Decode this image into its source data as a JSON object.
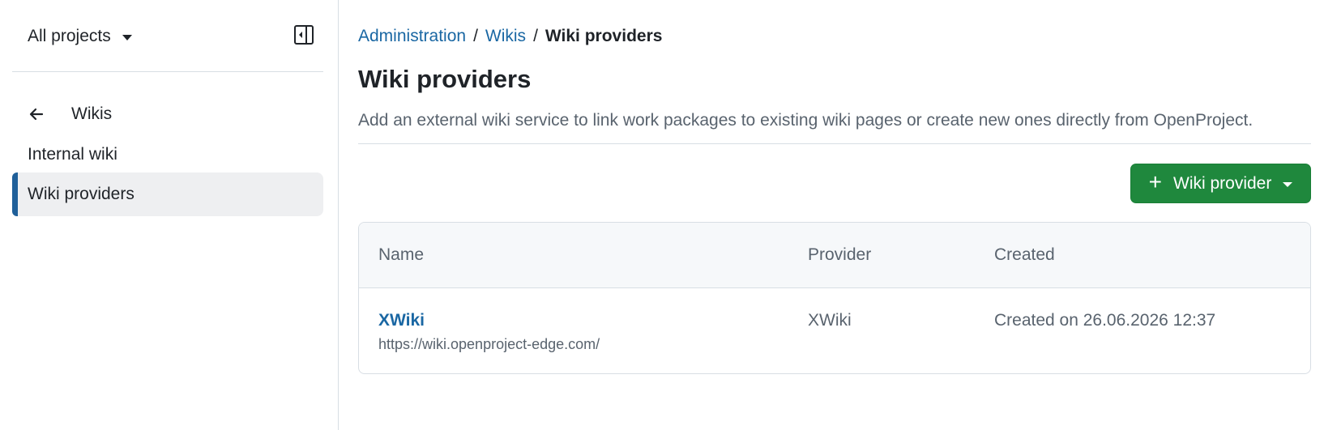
{
  "sidebar": {
    "project_selector": "All projects",
    "back_label": "Wikis",
    "items": [
      {
        "label": "Internal wiki",
        "active": false
      },
      {
        "label": "Wiki providers",
        "active": true
      }
    ]
  },
  "breadcrumb": {
    "items": [
      "Administration",
      "Wikis"
    ],
    "current": "Wiki providers",
    "separator": "/"
  },
  "page": {
    "title": "Wiki providers",
    "description": "Add an external wiki service to link work packages to existing wiki pages or create new ones directly from OpenProject."
  },
  "actions": {
    "add_provider": "Wiki provider"
  },
  "table": {
    "headers": [
      "Name",
      "Provider",
      "Created"
    ],
    "rows": [
      {
        "name": "XWiki",
        "url": "https://wiki.openproject-edge.com/",
        "provider": "XWiki",
        "created": "Created on 26.06.2026 12:37"
      }
    ]
  },
  "colors": {
    "primary_button": "#1f883d",
    "link": "#1a67a3",
    "active_indicator": "#1f5f99",
    "active_bg": "#eeeff1"
  },
  "icons": {
    "project_caret": "caret-down-icon",
    "collapse": "sidebar-collapse-icon",
    "back": "arrow-left-icon",
    "add": "plus-icon",
    "button_caret": "caret-down-icon"
  }
}
